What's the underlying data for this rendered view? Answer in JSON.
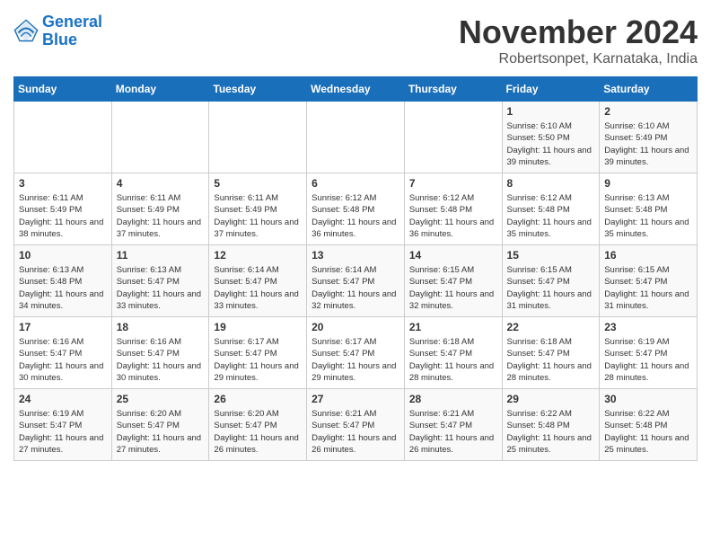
{
  "header": {
    "logo_line1": "General",
    "logo_line2": "Blue",
    "month_title": "November 2024",
    "location": "Robertsonpet, Karnataka, India"
  },
  "weekdays": [
    "Sunday",
    "Monday",
    "Tuesday",
    "Wednesday",
    "Thursday",
    "Friday",
    "Saturday"
  ],
  "weeks": [
    [
      {
        "day": "",
        "info": ""
      },
      {
        "day": "",
        "info": ""
      },
      {
        "day": "",
        "info": ""
      },
      {
        "day": "",
        "info": ""
      },
      {
        "day": "",
        "info": ""
      },
      {
        "day": "1",
        "info": "Sunrise: 6:10 AM\nSunset: 5:50 PM\nDaylight: 11 hours and 39 minutes."
      },
      {
        "day": "2",
        "info": "Sunrise: 6:10 AM\nSunset: 5:49 PM\nDaylight: 11 hours and 39 minutes."
      }
    ],
    [
      {
        "day": "3",
        "info": "Sunrise: 6:11 AM\nSunset: 5:49 PM\nDaylight: 11 hours and 38 minutes."
      },
      {
        "day": "4",
        "info": "Sunrise: 6:11 AM\nSunset: 5:49 PM\nDaylight: 11 hours and 37 minutes."
      },
      {
        "day": "5",
        "info": "Sunrise: 6:11 AM\nSunset: 5:49 PM\nDaylight: 11 hours and 37 minutes."
      },
      {
        "day": "6",
        "info": "Sunrise: 6:12 AM\nSunset: 5:48 PM\nDaylight: 11 hours and 36 minutes."
      },
      {
        "day": "7",
        "info": "Sunrise: 6:12 AM\nSunset: 5:48 PM\nDaylight: 11 hours and 36 minutes."
      },
      {
        "day": "8",
        "info": "Sunrise: 6:12 AM\nSunset: 5:48 PM\nDaylight: 11 hours and 35 minutes."
      },
      {
        "day": "9",
        "info": "Sunrise: 6:13 AM\nSunset: 5:48 PM\nDaylight: 11 hours and 35 minutes."
      }
    ],
    [
      {
        "day": "10",
        "info": "Sunrise: 6:13 AM\nSunset: 5:48 PM\nDaylight: 11 hours and 34 minutes."
      },
      {
        "day": "11",
        "info": "Sunrise: 6:13 AM\nSunset: 5:47 PM\nDaylight: 11 hours and 33 minutes."
      },
      {
        "day": "12",
        "info": "Sunrise: 6:14 AM\nSunset: 5:47 PM\nDaylight: 11 hours and 33 minutes."
      },
      {
        "day": "13",
        "info": "Sunrise: 6:14 AM\nSunset: 5:47 PM\nDaylight: 11 hours and 32 minutes."
      },
      {
        "day": "14",
        "info": "Sunrise: 6:15 AM\nSunset: 5:47 PM\nDaylight: 11 hours and 32 minutes."
      },
      {
        "day": "15",
        "info": "Sunrise: 6:15 AM\nSunset: 5:47 PM\nDaylight: 11 hours and 31 minutes."
      },
      {
        "day": "16",
        "info": "Sunrise: 6:15 AM\nSunset: 5:47 PM\nDaylight: 11 hours and 31 minutes."
      }
    ],
    [
      {
        "day": "17",
        "info": "Sunrise: 6:16 AM\nSunset: 5:47 PM\nDaylight: 11 hours and 30 minutes."
      },
      {
        "day": "18",
        "info": "Sunrise: 6:16 AM\nSunset: 5:47 PM\nDaylight: 11 hours and 30 minutes."
      },
      {
        "day": "19",
        "info": "Sunrise: 6:17 AM\nSunset: 5:47 PM\nDaylight: 11 hours and 29 minutes."
      },
      {
        "day": "20",
        "info": "Sunrise: 6:17 AM\nSunset: 5:47 PM\nDaylight: 11 hours and 29 minutes."
      },
      {
        "day": "21",
        "info": "Sunrise: 6:18 AM\nSunset: 5:47 PM\nDaylight: 11 hours and 28 minutes."
      },
      {
        "day": "22",
        "info": "Sunrise: 6:18 AM\nSunset: 5:47 PM\nDaylight: 11 hours and 28 minutes."
      },
      {
        "day": "23",
        "info": "Sunrise: 6:19 AM\nSunset: 5:47 PM\nDaylight: 11 hours and 28 minutes."
      }
    ],
    [
      {
        "day": "24",
        "info": "Sunrise: 6:19 AM\nSunset: 5:47 PM\nDaylight: 11 hours and 27 minutes."
      },
      {
        "day": "25",
        "info": "Sunrise: 6:20 AM\nSunset: 5:47 PM\nDaylight: 11 hours and 27 minutes."
      },
      {
        "day": "26",
        "info": "Sunrise: 6:20 AM\nSunset: 5:47 PM\nDaylight: 11 hours and 26 minutes."
      },
      {
        "day": "27",
        "info": "Sunrise: 6:21 AM\nSunset: 5:47 PM\nDaylight: 11 hours and 26 minutes."
      },
      {
        "day": "28",
        "info": "Sunrise: 6:21 AM\nSunset: 5:47 PM\nDaylight: 11 hours and 26 minutes."
      },
      {
        "day": "29",
        "info": "Sunrise: 6:22 AM\nSunset: 5:48 PM\nDaylight: 11 hours and 25 minutes."
      },
      {
        "day": "30",
        "info": "Sunrise: 6:22 AM\nSunset: 5:48 PM\nDaylight: 11 hours and 25 minutes."
      }
    ]
  ]
}
